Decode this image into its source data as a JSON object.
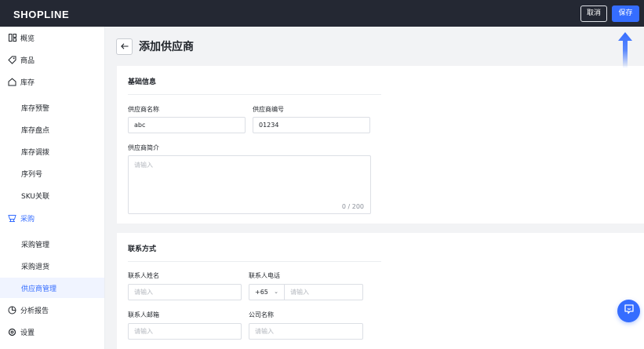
{
  "topbar": {
    "logo": "SHOPLINE",
    "cancel_label": "取消",
    "save_label": "保存"
  },
  "sidebar": {
    "items": [
      {
        "label": "概览",
        "icon": "dashboard-icon"
      },
      {
        "label": "商品",
        "icon": "tag-icon"
      },
      {
        "label": "库存",
        "icon": "home-icon"
      },
      {
        "label": "库存预警"
      },
      {
        "label": "库存盘点"
      },
      {
        "label": "库存调拨"
      },
      {
        "label": "序列号"
      },
      {
        "label": "SKU关联"
      },
      {
        "label": "采购",
        "icon": "purchase-icon"
      },
      {
        "label": "采购管理"
      },
      {
        "label": "采购退货"
      },
      {
        "label": "供应商管理"
      },
      {
        "label": "分析报告",
        "icon": "chart-icon"
      },
      {
        "label": "设置",
        "icon": "gear-icon"
      }
    ]
  },
  "page": {
    "title": "添加供应商"
  },
  "basic_info": {
    "title": "基础信息",
    "supplier_name_label": "供应商名称",
    "supplier_name_value": "abc",
    "supplier_code_label": "供应商编号",
    "supplier_code_value": "01234",
    "intro_label": "供应商简介",
    "intro_placeholder": "请输入",
    "intro_count": "0 / 200"
  },
  "contact": {
    "title": "联系方式",
    "contact_name_label": "联系人姓名",
    "contact_name_placeholder": "请输入",
    "phone_label": "联系人电话",
    "phone_code": "+65",
    "phone_placeholder": "请输入",
    "email_label": "联系人邮箱",
    "email_placeholder": "请输入",
    "company_label": "公司名称",
    "company_placeholder": "请输入"
  },
  "colors": {
    "topbar": "#242833",
    "accent": "#356dff",
    "active_bg": "#f0f4ff"
  }
}
